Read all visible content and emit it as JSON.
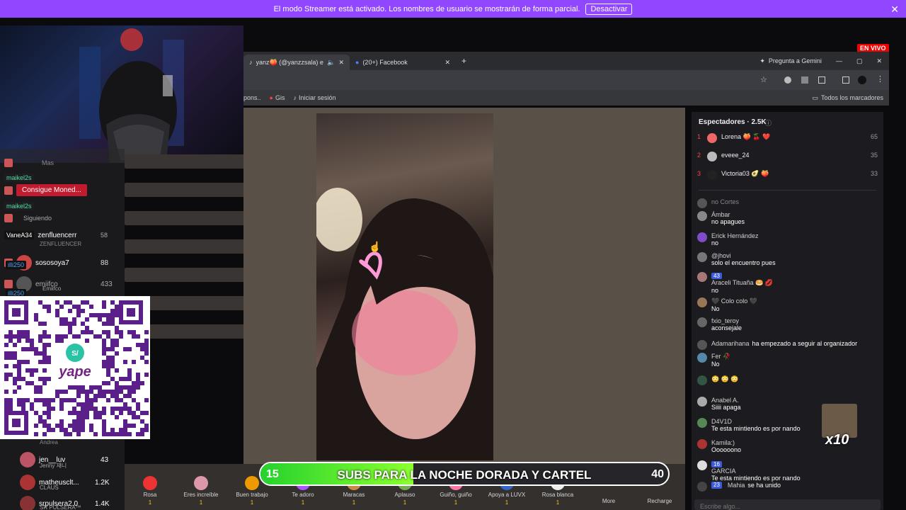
{
  "banner": {
    "text": "El modo Streamer está activado. Los nombres de usuario se mostrarán de forma parcial.",
    "button": "Desactivar"
  },
  "live_badge": "EN VIVO",
  "browser": {
    "tabs": [
      {
        "label": "yanz🍑 (@yanzzsala) es..."
      },
      {
        "label": "(20+) Facebook"
      }
    ],
    "gemini": "Pregunta a Gemini",
    "bookmarks": [
      "pons..",
      "Gis",
      "Iniciar sesión"
    ],
    "all_bookmarks": "Todos los marcadores"
  },
  "viewers": {
    "title": "Espectadores · 2.5K",
    "top": [
      {
        "rank": "1",
        "name": "Lorena 🍑 🍒 ❤️",
        "score": "65"
      },
      {
        "rank": "2",
        "name": "eveee_24",
        "score": "35"
      },
      {
        "rank": "3",
        "name": "Victoria03 🥑 🍑",
        "score": "33"
      }
    ]
  },
  "chat": [
    {
      "name": "",
      "text": "no Cortes"
    },
    {
      "name": "Ámbar",
      "text": "no apagues"
    },
    {
      "name": "Erick Hernández",
      "text": "no"
    },
    {
      "name": "@jhovi",
      "text": "solo el encuentro pues"
    },
    {
      "name": "Araceli Tituaña 🥯 💋",
      "badge": "43",
      "text": "no"
    },
    {
      "name": "🖤 Colo colo 🖤",
      "text": "No"
    },
    {
      "name": "fxio_teroy",
      "text": "aconsejale"
    },
    {
      "name": "Adamarihana",
      "text": "ha empezado a seguir al organizador",
      "inline": true
    },
    {
      "name": "Fer 🥀",
      "text": "No"
    },
    {
      "name": "",
      "text": "😳 😳 😳"
    },
    {
      "name": "Anabel A.",
      "text": "Siiii apaga"
    },
    {
      "name": "D4V1D",
      "text": "Te esta mintiendo es por nando"
    },
    {
      "name": "Kamila:)",
      "text": "Oooooono"
    },
    {
      "name": "GARCIA",
      "badge": "16",
      "text": "Te esta mintiendo es por nando"
    },
    {
      "name": "Mahia",
      "badge": "23",
      "text": "se ha unido",
      "inline": true
    }
  ],
  "chat_input_placeholder": "Escribe algo...",
  "x10": "x10",
  "left_chat": {
    "items": [
      {
        "name": "Mas",
        "tag": "",
        "count": ""
      },
      {
        "name": "Consigue Moned...",
        "tag": "maikel2s",
        "count": ""
      },
      {
        "name": "Siguiendo",
        "tag": "maikel2s",
        "count": ""
      },
      {
        "name": "zenfluencerr",
        "sub": "ZENFLUENCER",
        "tag": "VaneA34",
        "count": "58"
      },
      {
        "name": "sososoya7",
        "sub": "-",
        "tag": "illi250",
        "count": "88"
      },
      {
        "name": "emiifco",
        "sub": "Emiifco",
        "tag": "illi250",
        "count": "433"
      },
      {
        "name": "jen__luv",
        "sub": "Jenny 재니",
        "count": "43"
      },
      {
        "name": "matheusclt...",
        "sub": "CLAUS",
        "count": "1.2K"
      },
      {
        "name": "srpulsera2.0",
        "sub": "SR PULSERA™",
        "count": "1.4K"
      }
    ],
    "andrea": "Andrea"
  },
  "qr": {
    "logo": "yape",
    "symbol": "S/"
  },
  "gifts": [
    {
      "name": "Rosa",
      "price": "1"
    },
    {
      "name": "Eres increíble",
      "price": "1"
    },
    {
      "name": "Buen trabajo",
      "price": "1"
    },
    {
      "name": "Te adoro",
      "price": "1"
    },
    {
      "name": "Maracas",
      "price": "1"
    },
    {
      "name": "Aplauso",
      "price": "1"
    },
    {
      "name": "Guiño, guiño",
      "price": "1"
    },
    {
      "name": "Apoya a LUVX",
      "price": "1"
    },
    {
      "name": "Rosa blanca",
      "price": "1"
    },
    {
      "name": "More",
      "price": ""
    },
    {
      "name": "Recharge",
      "price": ""
    }
  ],
  "subs": {
    "current": "15",
    "goal": "40",
    "text": "SUBS PARA LA NOCHE DORADA Y CARTEL",
    "progress": 0.375
  },
  "colors": {
    "banner": "#9147ff",
    "progress": "#25d22d",
    "live": "#eb0400"
  }
}
